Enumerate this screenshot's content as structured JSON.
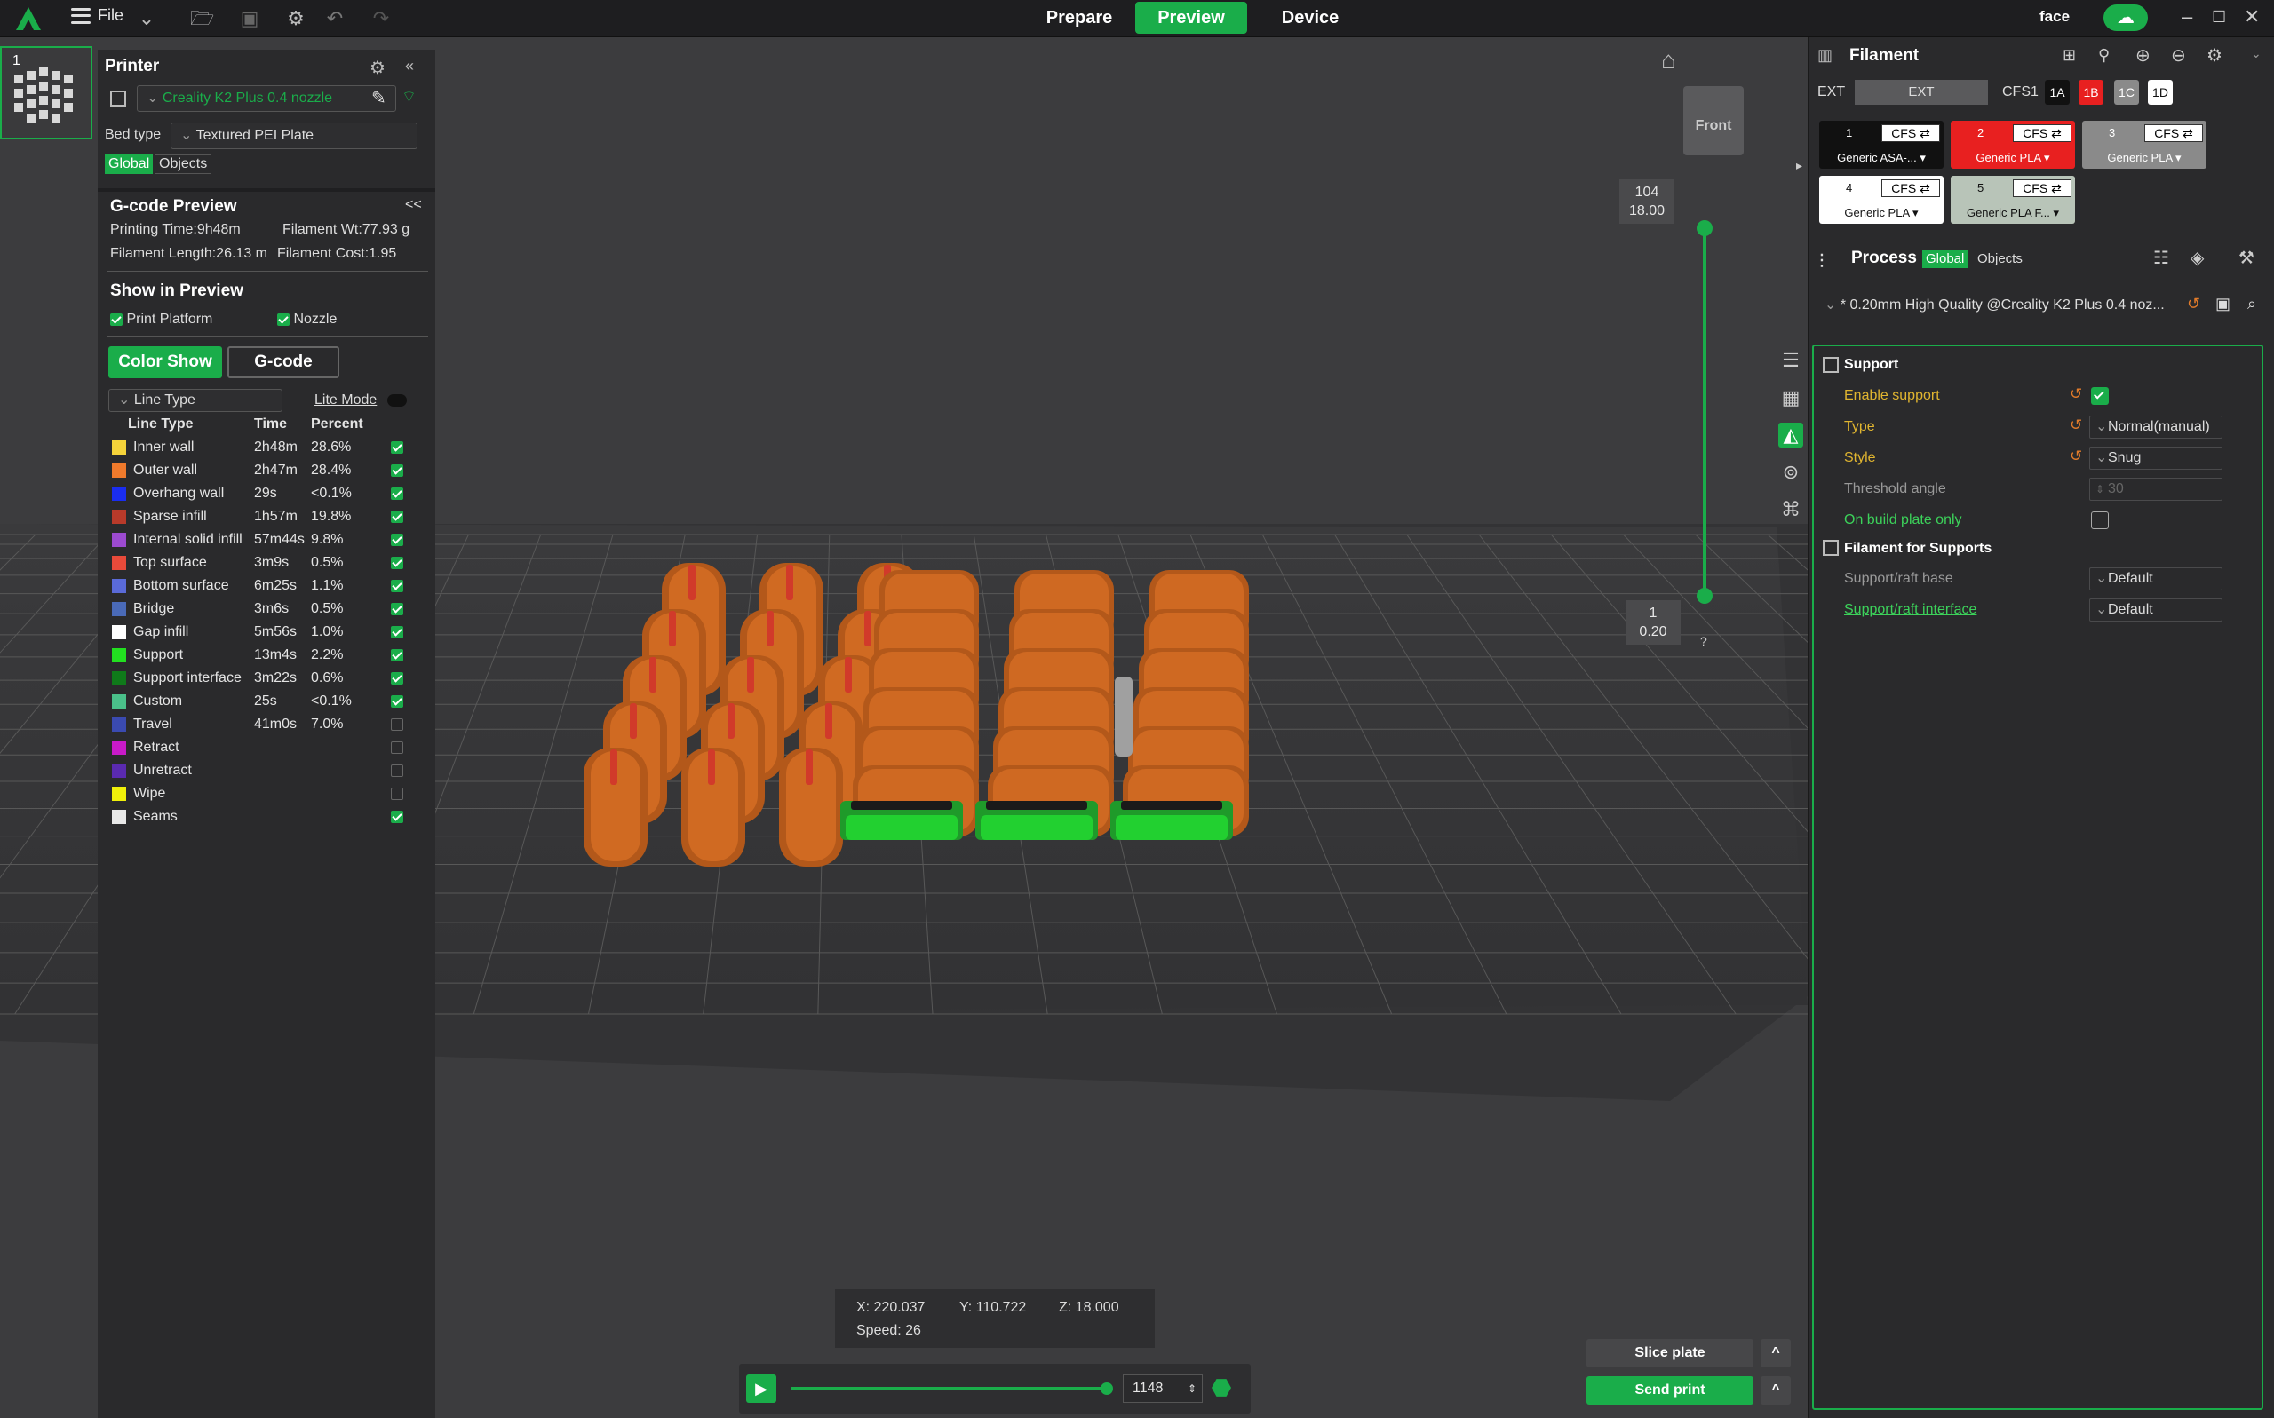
{
  "topbar": {
    "file_label": "File",
    "tabs": [
      "Prepare",
      "Preview",
      "Device"
    ],
    "user": "face"
  },
  "viewport": {
    "view_cube": "Front",
    "slider_top": {
      "layer": "104",
      "height": "18.00"
    },
    "slider_bottom": {
      "layer": "1",
      "height": "0.20"
    },
    "slider_help": "?",
    "coords": {
      "x": "X: 220.037",
      "y": "Y: 110.722",
      "z": "Z: 18.000",
      "speed": "Speed: 26"
    },
    "move_value": "1148",
    "move_progress": 0.99
  },
  "plate": {
    "number": "1"
  },
  "printer": {
    "title": "Printer",
    "name": "Creality K2 Plus 0.4 nozzle",
    "bed_label": "Bed type",
    "bed_value": "Textured PEI Plate",
    "tab_global": "Global",
    "tab_objects": "Objects"
  },
  "gcode": {
    "title": "G-code Preview",
    "collapse": "<<",
    "printing_time": "Printing Time:9h48m",
    "filament_wt": "Filament Wt:77.93 g",
    "filament_length": "Filament Length:26.13 m",
    "filament_cost": "Filament Cost:1.95",
    "show_title": "Show in Preview",
    "print_platform": "Print Platform",
    "nozzle": "Nozzle",
    "color_show": "Color Show",
    "gcode_btn": "G-code",
    "line_type_select": "Line Type",
    "lite_mode": "Lite Mode",
    "col_line_type": "Line Type",
    "col_time": "Time",
    "col_percent": "Percent",
    "rows": [
      {
        "name": "Inner wall",
        "time": "2h48m",
        "percent": "28.6%",
        "color": "#f5d33a",
        "checked": true
      },
      {
        "name": "Outer wall",
        "time": "2h47m",
        "percent": "28.4%",
        "color": "#f07a2c",
        "checked": true
      },
      {
        "name": "Overhang wall",
        "time": "29s",
        "percent": "<0.1%",
        "color": "#1a2df0",
        "checked": true
      },
      {
        "name": "Sparse infill",
        "time": "1h57m",
        "percent": "19.8%",
        "color": "#b83a2a",
        "checked": true
      },
      {
        "name": "Internal solid infill",
        "time": "57m44s",
        "percent": "9.8%",
        "color": "#9c4ad0",
        "checked": true
      },
      {
        "name": "Top surface",
        "time": "3m9s",
        "percent": "0.5%",
        "color": "#e84a3a",
        "checked": true
      },
      {
        "name": "Bottom surface",
        "time": "6m25s",
        "percent": "1.1%",
        "color": "#5a6ad8",
        "checked": true
      },
      {
        "name": "Bridge",
        "time": "3m6s",
        "percent": "0.5%",
        "color": "#4a6ab8",
        "checked": true
      },
      {
        "name": "Gap infill",
        "time": "5m56s",
        "percent": "1.0%",
        "color": "#ffffff",
        "checked": true
      },
      {
        "name": "Support",
        "time": "13m4s",
        "percent": "2.2%",
        "color": "#22e020",
        "checked": true
      },
      {
        "name": "Support interface",
        "time": "3m22s",
        "percent": "0.6%",
        "color": "#0f7a1a",
        "checked": true
      },
      {
        "name": "Custom",
        "time": "25s",
        "percent": "<0.1%",
        "color": "#4ac08a",
        "checked": true
      },
      {
        "name": "Travel",
        "time": "41m0s",
        "percent": "7.0%",
        "color": "#3a4ab0",
        "checked": false
      },
      {
        "name": "Retract",
        "time": "",
        "percent": "",
        "color": "#c81ac8",
        "checked": false
      },
      {
        "name": "Unretract",
        "time": "",
        "percent": "",
        "color": "#5a2ab0",
        "checked": false
      },
      {
        "name": "Wipe",
        "time": "",
        "percent": "",
        "color": "#f0f00a",
        "checked": false
      },
      {
        "name": "Seams",
        "time": "",
        "percent": "",
        "color": "#e8e8e8",
        "checked": true
      }
    ]
  },
  "filament": {
    "title": "Filament",
    "ext_label": "EXT",
    "ext_btn": "EXT",
    "cfs_label": "CFS1",
    "cfs_tabs": [
      "1A",
      "1B",
      "1C",
      "1D"
    ],
    "slots": [
      {
        "num": "1",
        "cfs": "CFS ⇄",
        "name": "Generic ASA-...",
        "bg": "#111111",
        "fg": "#ffffff"
      },
      {
        "num": "2",
        "cfs": "CFS ⇄",
        "name": "Generic PLA",
        "bg": "#e82020",
        "fg": "#ffffff"
      },
      {
        "num": "3",
        "cfs": "CFS ⇄",
        "name": "Generic PLA",
        "bg": "#8a8a8a",
        "fg": "#ffffff"
      },
      {
        "num": "4",
        "cfs": "CFS ⇄",
        "name": "Generic PLA",
        "bg": "#ffffff",
        "fg": "#111111"
      },
      {
        "num": "5",
        "cfs": "CFS ⇄",
        "name": "Generic PLA F...",
        "bg": "#b8c4b8",
        "fg": "#111111"
      }
    ]
  },
  "process": {
    "title": "Process",
    "tab_global": "Global",
    "tab_objects": "Objects",
    "preset": "* 0.20mm High Quality @Creality K2 Plus 0.4 noz...",
    "support_title": "Support",
    "enable_support": "Enable support",
    "type_label": "Type",
    "type_value": "Normal(manual)",
    "style_label": "Style",
    "style_value": "Snug",
    "threshold_label": "Threshold angle",
    "threshold_value": "30",
    "build_plate_only": "On build plate only",
    "fil_support_title": "Filament for Supports",
    "raft_base_label": "Support/raft base",
    "raft_base_value": "Default",
    "raft_interface_label": "Support/raft interface",
    "raft_interface_value": "Default"
  },
  "buttons": {
    "slice_plate": "Slice plate",
    "send_print": "Send print",
    "caret": "^"
  },
  "colors": {
    "accent": "#1aad4a",
    "model_orange": "#c4621e",
    "support_green": "#22c030"
  }
}
